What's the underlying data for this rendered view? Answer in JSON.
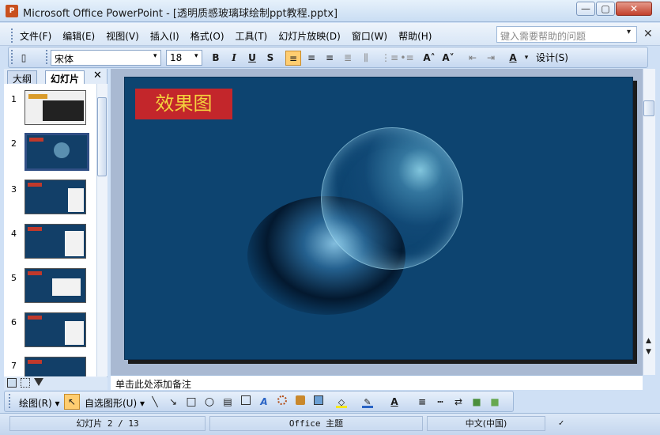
{
  "window": {
    "title": "Microsoft Office PowerPoint - [透明质感玻璃球绘制ppt教程.pptx]",
    "icon_text": "P",
    "min_label": "—",
    "max_label": "▢",
    "close_label": "✕"
  },
  "menu": {
    "items": [
      "文件(F)",
      "编辑(E)",
      "视图(V)",
      "插入(I)",
      "格式(O)",
      "工具(T)",
      "幻灯片放映(D)",
      "窗口(W)",
      "帮助(H)"
    ],
    "help_placeholder": "键入需要帮助的问题",
    "help_arrow": "▾",
    "close": "✕"
  },
  "toolbar": {
    "font_name": "宋体",
    "font_size": "18",
    "bold": "B",
    "italic": "I",
    "underline": "U",
    "shadow": "S",
    "design_label": "设计(S)",
    "dropdown_arrow": "▾",
    "new_icon_text": "▯",
    "align_left": "≡",
    "align_center": "≡",
    "align_right": "≡",
    "justify": "≣",
    "columns": "⫼",
    "numbering": "⋮≡",
    "bullets": "•≡",
    "increase_font": "A˄",
    "decrease_font": "A˅",
    "decrease_indent": "⇤",
    "increase_indent": "⇥",
    "font_color": "A"
  },
  "left_pane": {
    "tab_outline": "大纲",
    "tab_slides": "幻灯片",
    "close": "✕",
    "slide_numbers": [
      "1",
      "2",
      "3",
      "4",
      "5",
      "6",
      "7"
    ],
    "selected_slide": 2
  },
  "slide": {
    "title": "效果图"
  },
  "notes": {
    "placeholder": "单击此处添加备注"
  },
  "draw_toolbar": {
    "draw_label": "绘图(R) ▾",
    "pointer": "↖",
    "autoshape_label": "自选图形(U) ▾",
    "line": "╲",
    "arrow": "↘",
    "rectangle": "□",
    "oval": "○",
    "textbox": "▤",
    "wordart": "A",
    "fill_color": "◇",
    "line_color": "✎",
    "font_color": "A",
    "line_style": "≡",
    "dash_style": "┅",
    "arrow_style": "⇄",
    "shadow": "■",
    "three_d": "■"
  },
  "status": {
    "slide": "幻灯片 2 / 13",
    "theme": "Office 主题",
    "language": "中文(中国)",
    "spell_icon_text": "✓"
  },
  "colors": {
    "slide_background": "#0d4470",
    "title_box": "#c3262b",
    "title_text": "#f4d23d",
    "selection_accent": "#ffcd70"
  }
}
